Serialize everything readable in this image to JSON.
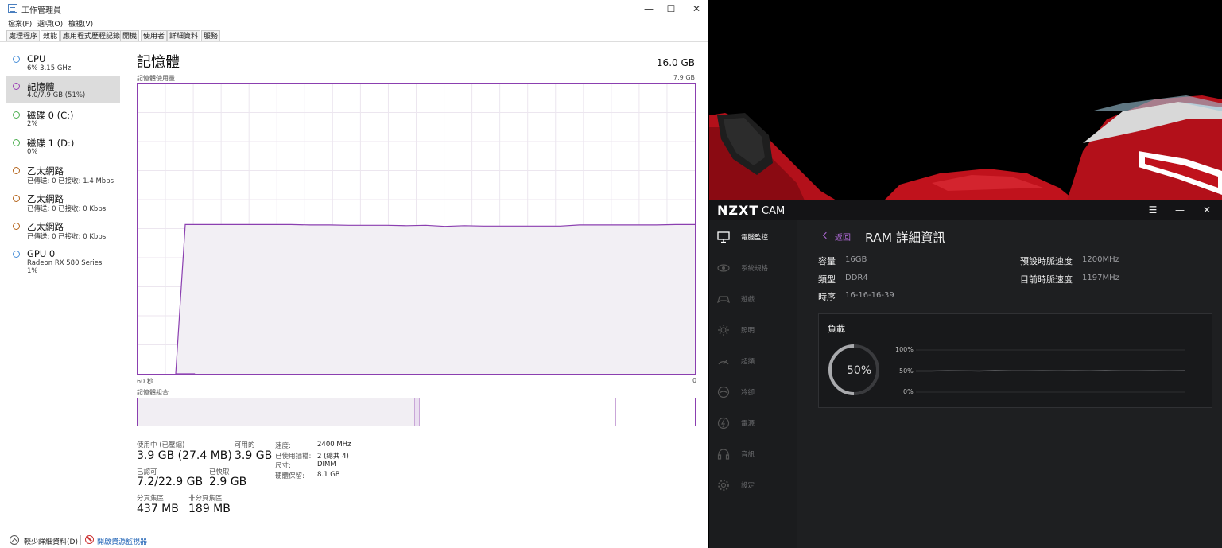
{
  "task_manager": {
    "window_title": "工作管理員",
    "controls": {
      "minimize": "—",
      "maximize": "☐",
      "close": "✕"
    },
    "menu": [
      "檔案(F)",
      "選項(O)",
      "檢視(V)"
    ],
    "tabs": [
      "處理程序",
      "效能",
      "應用程式歷程記錄",
      "開機",
      "使用者",
      "詳細資料",
      "服務"
    ],
    "active_tab": "效能",
    "sidebar": [
      {
        "name": "CPU",
        "sub": "6% 3.15 GHz",
        "color": "#4a90d9"
      },
      {
        "name": "記憶體",
        "sub": "4.0/7.9 GB (51%)",
        "color": "#9b3fb5",
        "selected": true
      },
      {
        "name": "磁碟 0 (C:)",
        "sub": "2%",
        "color": "#4caf50"
      },
      {
        "name": "磁碟 1 (D:)",
        "sub": "0%",
        "color": "#4caf50"
      },
      {
        "name": "乙太網路",
        "sub": "已傳送: 0 已接收: 1.4 Mbps",
        "color": "#b5651d"
      },
      {
        "name": "乙太網路",
        "sub": "已傳送: 0 已接收: 0 Kbps",
        "color": "#b5651d"
      },
      {
        "name": "乙太網路",
        "sub": "已傳送: 0 已接收: 0 Kbps",
        "color": "#b5651d"
      },
      {
        "name": "GPU 0",
        "sub": "Radeon RX 580 Series",
        "sub2": "1%",
        "color": "#4a90d9"
      }
    ],
    "panel": {
      "title": "記憶體",
      "total": "16.0 GB",
      "usage_label": "記憶體使用量",
      "usage_max": "7.9 GB",
      "time_left": "60 秒",
      "time_right": "0",
      "composition_label": "記憶體組合",
      "accent": "#8b3fb0"
    },
    "usage_history": {
      "unit": "GB",
      "max": 7.9,
      "samples": [
        0,
        0,
        0,
        4.06,
        4.06,
        4.06,
        4.06,
        4.05,
        4.05,
        4.04,
        4.04,
        4.04,
        4.03,
        4.04,
        4.01,
        4.03,
        4.02,
        4.02,
        4.02,
        4.02,
        4.02,
        4.05,
        4.05,
        4.05,
        4.05,
        4.05,
        4.06,
        4.06
      ]
    },
    "stats": [
      {
        "label": "使用中 (已壓縮)",
        "value": "3.9 GB (27.4 MB)"
      },
      {
        "label": "可用的",
        "value": "3.9 GB"
      },
      {
        "label": "已認可",
        "value": "7.2/22.9 GB"
      },
      {
        "label": "已快取",
        "value": "2.9 GB"
      },
      {
        "label": "分頁集區",
        "value": "437 MB"
      },
      {
        "label": "非分頁集區",
        "value": "189 MB"
      }
    ],
    "specs": [
      {
        "label": "速度:",
        "value": "2400 MHz"
      },
      {
        "label": "已使用插槽:",
        "value": "2 (總共 4)"
      },
      {
        "label": "尺寸:",
        "value": "DIMM"
      },
      {
        "label": "硬體保留:",
        "value": "8.1 GB"
      }
    ],
    "footer": {
      "fewer_details": "較少詳細資料(D)",
      "resource_monitor": "開啟資源監視器"
    }
  },
  "nzxt": {
    "logo": "NZXT",
    "logo_suffix": "CAM",
    "window_controls": {
      "menu": "☰",
      "minimize": "—",
      "close": "✕"
    },
    "nav": [
      {
        "label": "電腦監控",
        "icon": "monitor-icon",
        "active": true
      },
      {
        "label": "系統規格",
        "icon": "eye-icon"
      },
      {
        "label": "遊戲",
        "icon": "gamepad-icon"
      },
      {
        "label": "照明",
        "icon": "lighting-icon"
      },
      {
        "label": "超頻",
        "icon": "overclock-icon"
      },
      {
        "label": "冷卻",
        "icon": "cooling-icon"
      },
      {
        "label": "電源",
        "icon": "power-icon"
      },
      {
        "label": "音訊",
        "icon": "headset-icon"
      },
      {
        "label": "設定",
        "icon": "settings-icon"
      }
    ],
    "back_label": "返回",
    "page_title": "RAM 詳細資訊",
    "props_left": [
      {
        "label": "容量",
        "value": "16GB"
      },
      {
        "label": "類型",
        "value": "DDR4"
      },
      {
        "label": "時序",
        "value": "16-16-16-39"
      }
    ],
    "props_right": [
      {
        "label": "預設時脈速度",
        "value": "1200MHz"
      },
      {
        "label": "目前時脈速度",
        "value": "1197MHz"
      }
    ],
    "load": {
      "title": "負載",
      "value_text": "50%",
      "percent": 50,
      "axis": [
        "100%",
        "50%",
        "0%"
      ],
      "history": [
        50,
        50,
        50.5,
        50.3,
        50,
        50.8,
        50.4,
        50.2,
        50.6,
        50.1,
        50.5,
        50.3,
        50.7,
        50.2,
        50.4,
        50.6,
        50.3,
        50.5
      ]
    }
  }
}
